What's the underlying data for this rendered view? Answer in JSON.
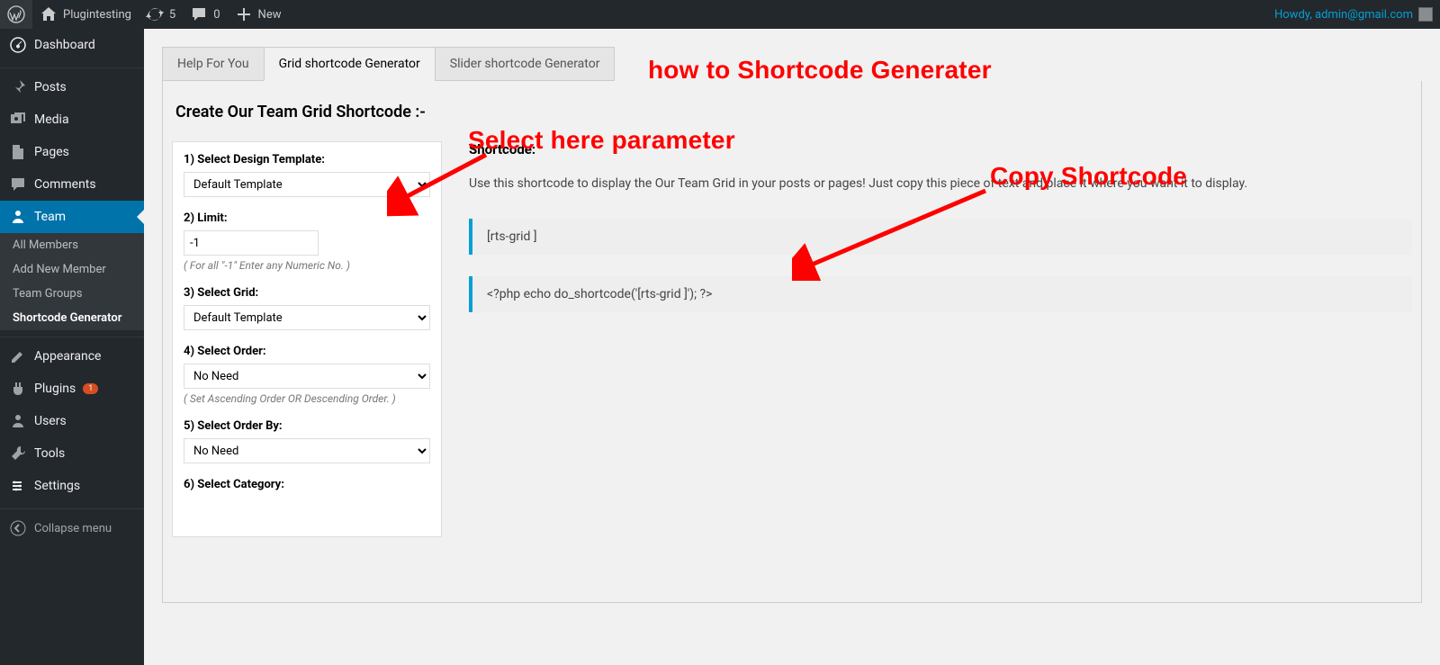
{
  "adminbar": {
    "site_name": "Plugintesting",
    "updates_count": "5",
    "comments_count": "0",
    "new_label": "New",
    "greeting": "Howdy, admin@gmail.com"
  },
  "sidebar": {
    "dashboard": "Dashboard",
    "posts": "Posts",
    "media": "Media",
    "pages": "Pages",
    "comments": "Comments",
    "team": "Team",
    "team_sub": {
      "all": "All Members",
      "add": "Add New Member",
      "groups": "Team Groups",
      "gen": "Shortcode Generator"
    },
    "appearance": "Appearance",
    "plugins": "Plugins",
    "plugins_badge": "1",
    "users": "Users",
    "tools": "Tools",
    "settings": "Settings",
    "collapse": "Collapse menu"
  },
  "tabs": {
    "help": "Help For You",
    "grid": "Grid shortcode Generator",
    "slider": "Slider shortcode Generator"
  },
  "page": {
    "title": "Create Our Team Grid Shortcode :-"
  },
  "fields": {
    "f1_label": "1) Select Design Template:",
    "f1_value": "Default Template",
    "f2_label": "2) Limit:",
    "f2_value": "-1",
    "f2_hint": "( For all \"-1\" Enter any Numeric No. )",
    "f3_label": "3) Select Grid:",
    "f3_value": "Default Template",
    "f4_label": "4) Select Order:",
    "f4_value": "No Need",
    "f4_hint": "( Set Ascending Order OR Descending Order. )",
    "f5_label": "5) Select Order By:",
    "f5_value": "No Need",
    "f6_label": "6) Select Category:"
  },
  "output": {
    "heading": "Shortcode:",
    "desc": "Use this shortcode to display the Our Team Grid in your posts or pages! Just copy this piece of text and place it where you want it to display.",
    "code1": "[rts-grid ]",
    "code2": "<?php echo do_shortcode('[rts-grid ]'); ?>"
  },
  "annot": {
    "a1": "how to Shortcode Generater",
    "a2": "Select here parameter",
    "a3": "Copy Shortcode"
  }
}
